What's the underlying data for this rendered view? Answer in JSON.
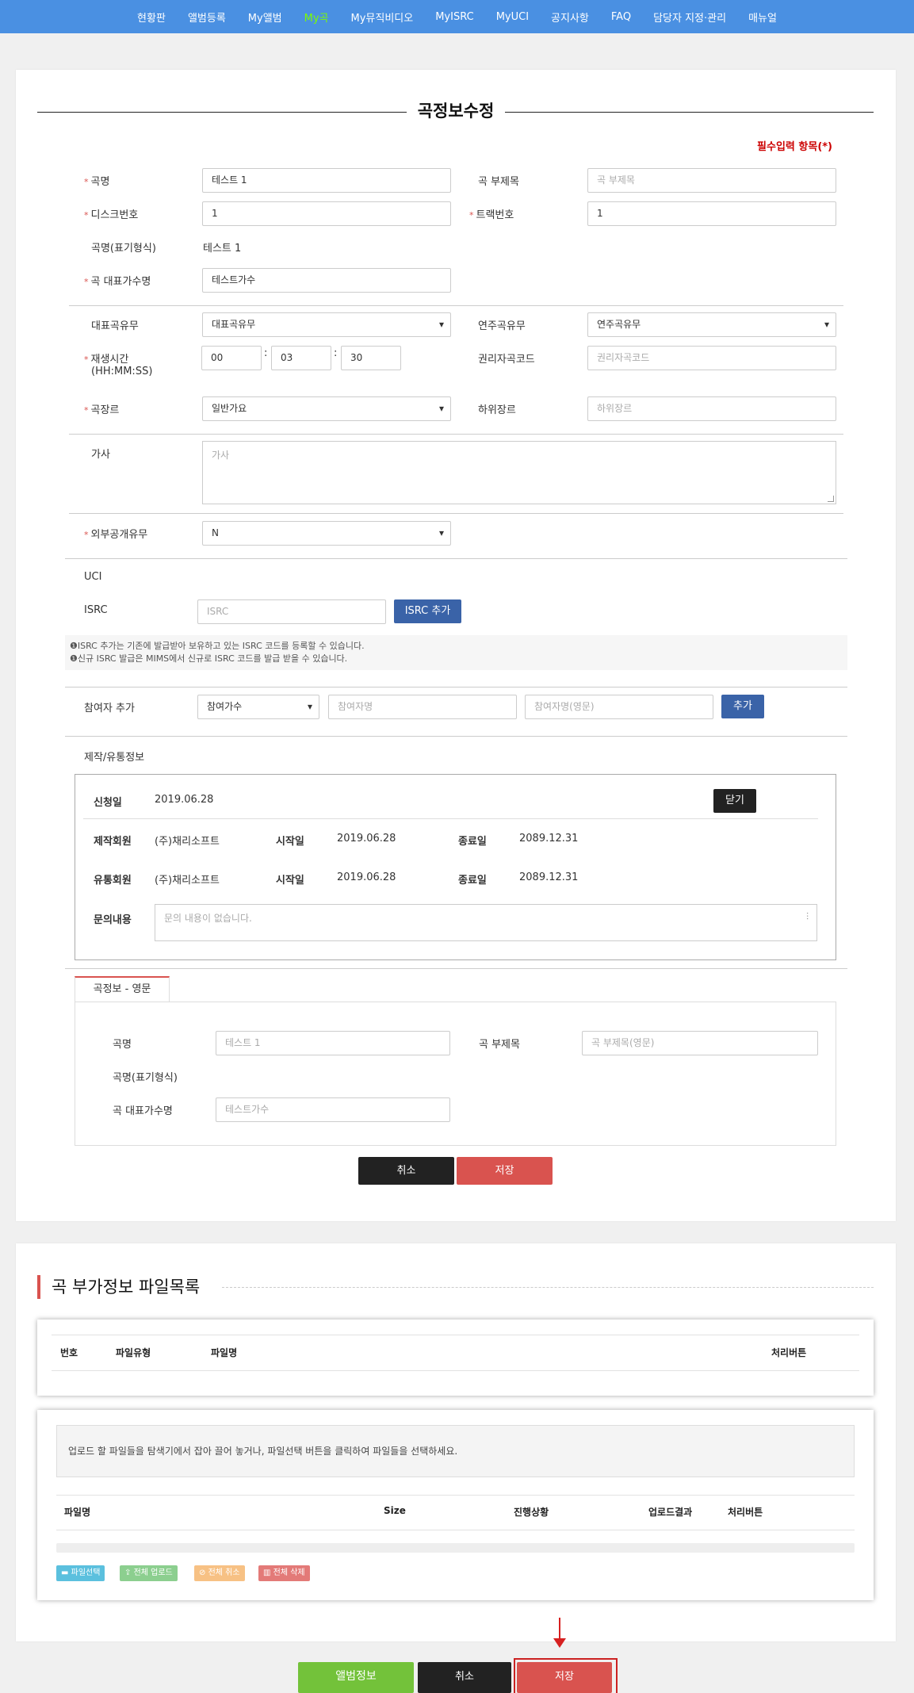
{
  "nav": {
    "items": [
      "현황판",
      "앨범등록",
      "My앨범",
      "My곡",
      "My뮤직비디오",
      "MyISRC",
      "MyUCI",
      "공지사항",
      "FAQ",
      "담당자 지정·관리",
      "매뉴얼"
    ],
    "active_index": 3
  },
  "form": {
    "title": "곡정보수정",
    "required_note": "필수입력 항목(*)",
    "song_name_label": "곡명",
    "song_name_value": "테스트 1",
    "subtitle_label": "곡 부제목",
    "subtitle_placeholder": "곡 부제목",
    "disc_label": "디스크번호",
    "disc_value": "1",
    "track_label": "트랙번호",
    "track_value": "1",
    "display_name_label": "곡명(표기형식)",
    "display_name_value": "테스트 1",
    "artist_label": "곡 대표가수명",
    "artist_value": "테스트가수",
    "rep_song_label": "대표곡유무",
    "rep_song_value": "대표곡유무",
    "performance_label": "연주곡유무",
    "performance_value": "연주곡유무",
    "playtime_label": "재생시간",
    "playtime_format": "(HH:MM:SS)",
    "playtime_h": "00",
    "playtime_m": "03",
    "playtime_s": "30",
    "colon": ":",
    "rights_code_label": "권리자곡코드",
    "rights_code_placeholder": "권리자곡코드",
    "genre_label": "곡장르",
    "genre_value": "일반가요",
    "subgenre_label": "하위장르",
    "subgenre_placeholder": "하위장르",
    "lyrics_label": "가사",
    "lyrics_placeholder": "가사",
    "public_label": "외부공개유무",
    "public_value": "N",
    "uci_label": "UCI",
    "isrc_label": "ISRC",
    "isrc_placeholder": "ISRC",
    "isrc_add_button": "ISRC 추가",
    "isrc_note_1": "❶ISRC 추가는 기존에 발급받아 보유하고 있는 ISRC 코드를 등록할 수 있습니다.",
    "isrc_note_2": "❶신규 ISRC 발급은 MIMS에서 신규로 ISRC 코드를 발급 받을 수 있습니다.",
    "participant_label": "참여자 추가",
    "participant_select": "참여가수",
    "participant_name_placeholder": "참여자명",
    "participant_name_en_placeholder": "참여자명(영문)",
    "participant_add_button": "추가",
    "production_label": "제작/유통정보",
    "apply_date_label": "신청일",
    "apply_date_value": "2019.06.28",
    "close_button": "닫기",
    "producer_label": "제작회원",
    "producer_value": "(주)채리소프트",
    "start_label": "시작일",
    "producer_start": "2019.06.28",
    "end_label": "종료일",
    "producer_end": "2089.12.31",
    "distributor_label": "유통회원",
    "distributor_value": "(주)채리소프트",
    "distributor_start": "2019.06.28",
    "distributor_end": "2089.12.31",
    "inquiry_label": "문의내용",
    "inquiry_placeholder": "문의 내용이 없습니다.",
    "en_tab_label": "곡정보 - 영문",
    "en_song_name_label": "곡명",
    "en_song_name_placeholder": "테스트 1",
    "en_subtitle_label": "곡 부제목",
    "en_subtitle_placeholder": "곡 부제목(영문)",
    "en_display_name_label": "곡명(표기형식)",
    "en_artist_label": "곡 대표가수명",
    "en_artist_placeholder": "테스트가수",
    "cancel_button": "취소",
    "save_button": "저장"
  },
  "files": {
    "section_title": "곡 부가정보 파일목록",
    "list_headers": [
      "번호",
      "파일유형",
      "파일명",
      "처리버튼"
    ],
    "drop_hint": "업로드 할 파일들을 탐색기에서 잡아 끌어 놓거나, 파일선택 버튼을 클릭하여 파일들을 선택하세요.",
    "upload_headers": [
      "파일명",
      "Size",
      "진행상황",
      "업로드결과",
      "처리버튼"
    ],
    "select_files": "파일선택",
    "upload_all": "전체 업로드",
    "cancel_all": "전체 취소",
    "delete_all": "전체 삭제"
  },
  "footer": {
    "album_info_button": "앨범정보",
    "cancel_button": "취소",
    "save_button": "저장"
  },
  "colors": {
    "nav_bg": "#4a90e2",
    "active_nav": "#7cfc00",
    "accent_red": "#d9534f",
    "blue_button": "#3a63a8",
    "green_button": "#73c23a"
  }
}
